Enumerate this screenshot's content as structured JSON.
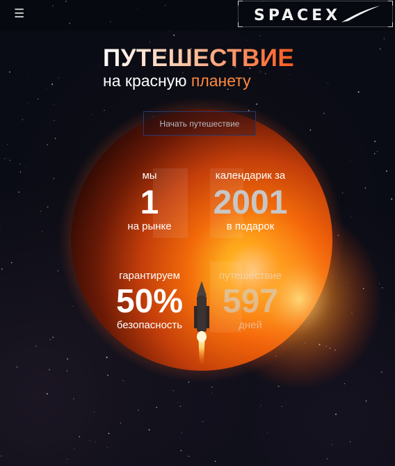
{
  "header": {
    "menu_icon": "hamburger-menu-icon",
    "logo_text": "SPACEX"
  },
  "hero": {
    "title": "ПУТЕШЕСТВИЕ",
    "subtitle_part1": "на красную",
    "subtitle_part2": "планету",
    "start_button": "Начать путешествие"
  },
  "stats": [
    {
      "label": "мы",
      "value": "1",
      "caption": "на рынке"
    },
    {
      "label": "календарик за",
      "value": "2001",
      "caption": "в подарок"
    },
    {
      "label": "гарантируем",
      "value": "50%",
      "caption": "безопасность"
    },
    {
      "label": "путешествие",
      "value": "597",
      "caption": "дней"
    }
  ],
  "colors": {
    "accent_orange": "#ff5a1e",
    "button_border": "#283a6a"
  }
}
